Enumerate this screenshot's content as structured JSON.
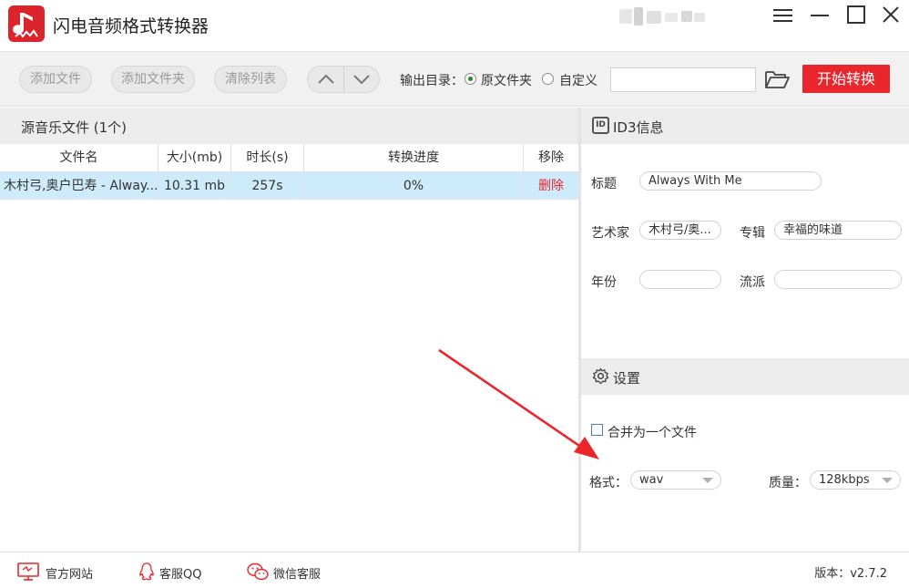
{
  "app": {
    "title": "闪电音频格式转换器",
    "accent": "#e8262b"
  },
  "toolbar": {
    "add_file": "添加文件",
    "add_folder": "添加文件夹",
    "clear_list": "清除列表",
    "output_dir_label": "输出目录：",
    "option_source_folder": "原文件夹",
    "option_custom": "自定义",
    "output_path_value": "",
    "start": "开始转换"
  },
  "file_list": {
    "header": "源音乐文件 (1个)",
    "columns": [
      "文件名",
      "大小(mb)",
      "时长(s)",
      "转换进度",
      "移除"
    ],
    "rows": [
      {
        "name": "木村弓,奥户巴寿 - Alway...",
        "size": "10.31 mb",
        "duration": "257s",
        "progress": "0%",
        "remove": "删除"
      }
    ]
  },
  "id3": {
    "header": "ID3信息",
    "icon_text": "ID",
    "title_label": "标题",
    "title_value": "Always With Me",
    "artist_label": "艺术家",
    "artist_value": "木村弓/奥...",
    "album_label": "专辑",
    "album_value": "幸福的味道",
    "year_label": "年份",
    "year_value": "",
    "genre_label": "流派",
    "genre_value": ""
  },
  "settings": {
    "header": "设置",
    "merge_label": "合并为一个文件",
    "merge_checked": false,
    "format_label": "格式：",
    "format_value": "wav",
    "quality_label": "质量：",
    "quality_value": "128kbps"
  },
  "footer": {
    "website": "官方网站",
    "qq_support": "客服QQ",
    "wechat_support": "微信客服",
    "version": "版本：v2.7.2"
  }
}
